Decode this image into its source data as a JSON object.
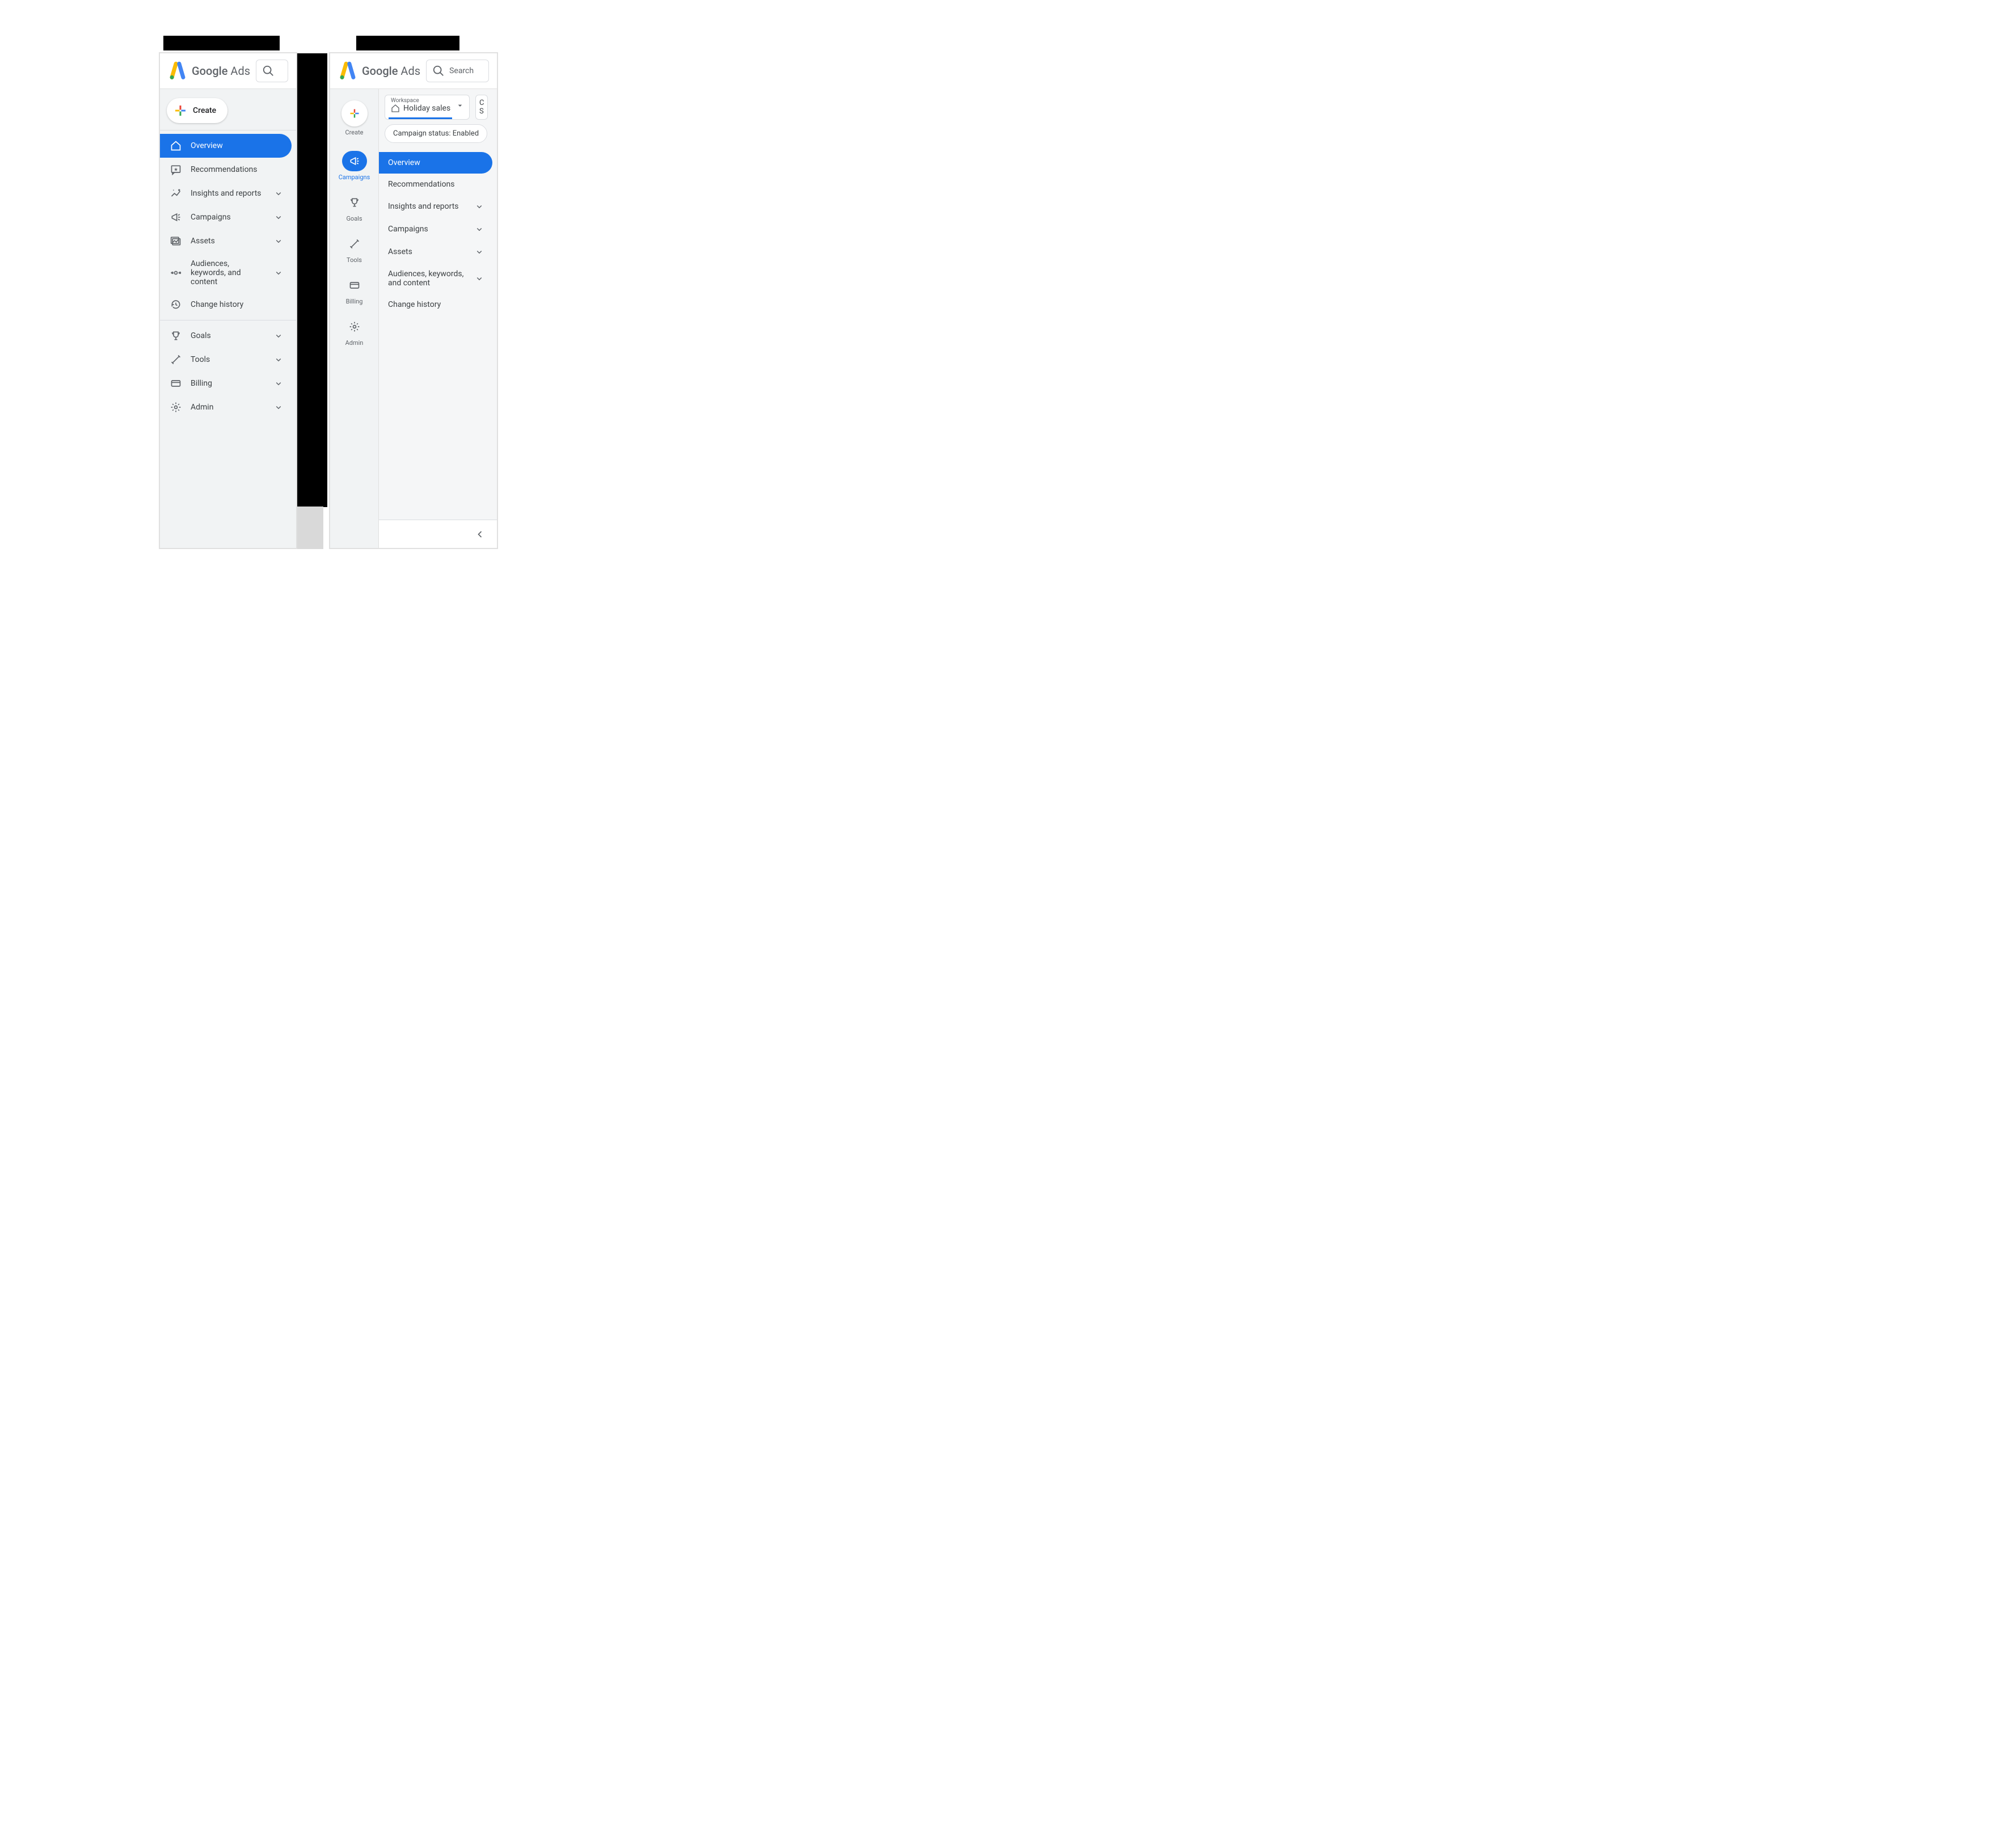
{
  "product": {
    "google": "Google",
    "ads": " Ads"
  },
  "search": {
    "placeholder": "Search"
  },
  "create": {
    "label": "Create"
  },
  "left_nav": {
    "primary": [
      {
        "label": "Overview",
        "active": true
      },
      {
        "label": "Recommendations"
      },
      {
        "label": "Insights and reports",
        "expandable": true
      },
      {
        "label": "Campaigns",
        "expandable": true
      },
      {
        "label": "Assets",
        "expandable": true
      },
      {
        "label": "Audiences, keywords, and content",
        "expandable": true
      },
      {
        "label": "Change history"
      }
    ],
    "secondary": [
      {
        "label": "Goals",
        "expandable": true
      },
      {
        "label": "Tools",
        "expandable": true
      },
      {
        "label": "Billing",
        "expandable": true
      },
      {
        "label": "Admin",
        "expandable": true
      }
    ]
  },
  "mini_rail": {
    "items": [
      {
        "label": "Create"
      },
      {
        "label": "Campaigns",
        "active": true
      },
      {
        "label": "Goals"
      },
      {
        "label": "Tools"
      },
      {
        "label": "Billing"
      },
      {
        "label": "Admin"
      }
    ]
  },
  "workspace": {
    "label": "Workspace",
    "value": "Holiday sales"
  },
  "partial_button": {
    "line1": "C",
    "line2": "S"
  },
  "status_pill": "Campaign status: Enabled",
  "right_nav": [
    {
      "label": "Overview",
      "active": true
    },
    {
      "label": "Recommendations"
    },
    {
      "label": "Insights and reports",
      "expandable": true
    },
    {
      "label": "Campaigns",
      "expandable": true
    },
    {
      "label": "Assets",
      "expandable": true
    },
    {
      "label": "Audiences, keywords, and content",
      "expandable": true
    },
    {
      "label": "Change history"
    }
  ]
}
